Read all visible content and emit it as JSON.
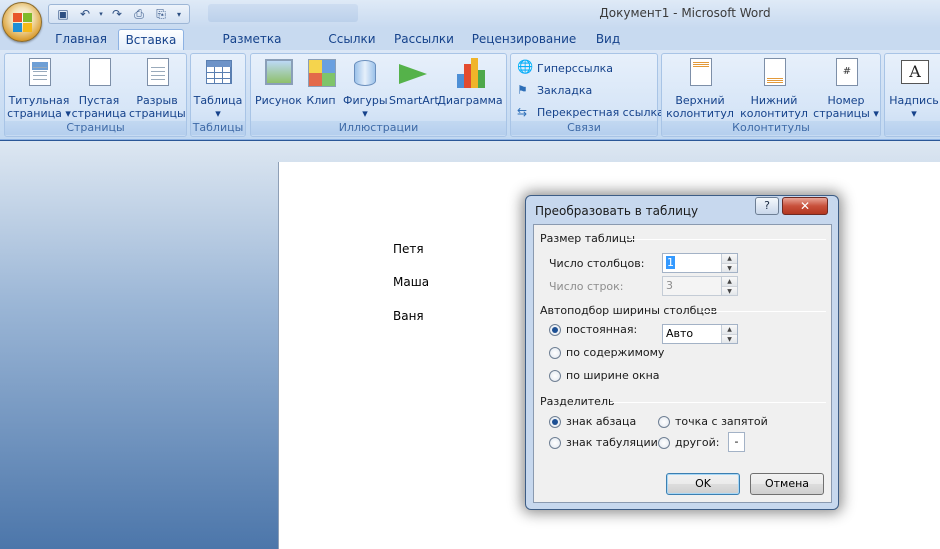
{
  "window": {
    "title": "Документ1 - Microsoft Word"
  },
  "qat": {
    "icons": [
      "save-icon",
      "undo-icon",
      "redo-icon",
      "print-preview-icon",
      "quick-print-icon",
      "customize-qat-icon"
    ]
  },
  "tabs": [
    {
      "label": "Главная",
      "active": false
    },
    {
      "label": "Вставка",
      "active": true
    },
    {
      "label": "Разметка страницы",
      "active": false
    },
    {
      "label": "Ссылки",
      "active": false
    },
    {
      "label": "Рассылки",
      "active": false
    },
    {
      "label": "Рецензирование",
      "active": false
    },
    {
      "label": "Вид",
      "active": false
    }
  ],
  "ribbon": {
    "groups": [
      {
        "label": "Страницы",
        "buttons": [
          {
            "line1": "Титульная",
            "line2": "страница ▾"
          },
          {
            "line1": "Пустая",
            "line2": "страница"
          },
          {
            "line1": "Разрыв",
            "line2": "страницы"
          }
        ]
      },
      {
        "label": "Таблицы",
        "buttons": [
          {
            "line1": "Таблица",
            "line2": "▾"
          }
        ]
      },
      {
        "label": "Иллюстрации",
        "buttons": [
          {
            "line1": "Рисунок",
            "line2": ""
          },
          {
            "line1": "Клип",
            "line2": ""
          },
          {
            "line1": "Фигуры",
            "line2": "▾"
          },
          {
            "line1": "SmartArt",
            "line2": ""
          },
          {
            "line1": "Диаграмма",
            "line2": ""
          }
        ]
      },
      {
        "label": "Связи",
        "buttons": [
          {
            "line1": "Гиперссылка"
          },
          {
            "line1": "Закладка"
          },
          {
            "line1": "Перекрестная ссылка"
          }
        ]
      },
      {
        "label": "Колонтитулы",
        "buttons": [
          {
            "line1": "Верхний",
            "line2": "колонтитул ▾"
          },
          {
            "line1": "Нижний",
            "line2": "колонтитул ▾"
          },
          {
            "line1": "Номер",
            "line2": "страницы ▾"
          }
        ]
      },
      {
        "label": "",
        "buttons": [
          {
            "line1": "Надпись",
            "line2": "▾"
          }
        ]
      }
    ]
  },
  "document": {
    "paragraphs": [
      "Петя",
      "Маша",
      "Ваня"
    ]
  },
  "dialog": {
    "title": "Преобразовать в таблицу",
    "help": "?",
    "close": "✕",
    "table_size": {
      "heading": "Размер таблицы",
      "columns_label": "Число столбцов:",
      "columns_value": "1",
      "rows_label": "Число строк:",
      "rows_value": "3"
    },
    "autofit": {
      "heading": "Автоподбор ширины столбцов",
      "fixed_label": "постоянная:",
      "fixed_value": "Авто",
      "content_label": "по содержимому",
      "window_label": "по ширине окна",
      "selected": "fixed"
    },
    "separator": {
      "heading": "Разделитель",
      "paragraph_label": "знак абзаца",
      "tab_label": "знак табуляции",
      "semicolon_label": "точка с запятой",
      "other_label": "другой:",
      "other_value": "-",
      "selected": "paragraph"
    },
    "ok_label": "OK",
    "cancel_label": "Отмена"
  },
  "colors": {
    "ribbon": "#cddff4",
    "accent": "#15428b",
    "dialog_frame": "#c7d8ee",
    "close_button": "#c8503b"
  }
}
